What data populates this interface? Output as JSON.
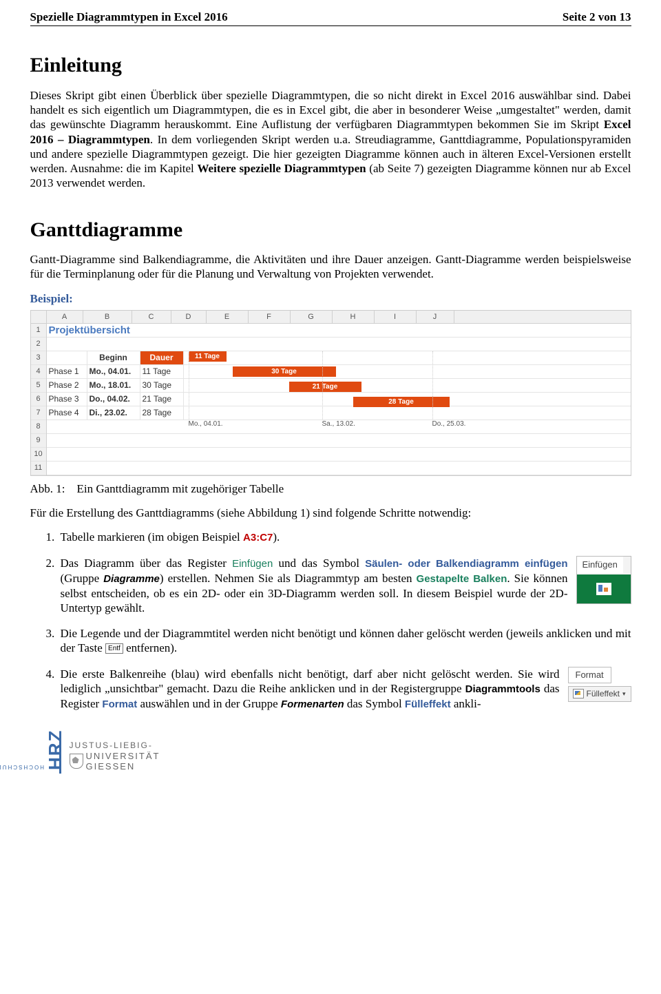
{
  "header": {
    "left": "Spezielle Diagrammtypen in Excel 2016",
    "right": "Seite 2 von 13"
  },
  "section1": {
    "title": "Einleitung",
    "para": "Dieses Skript gibt einen Überblick über spezielle Diagrammtypen, die so nicht direkt in Excel 2016 auswählbar sind. Dabei handelt es sich eigentlich um Diagrammtypen, die es in Excel gibt, die aber in besonderer Weise „umgestaltet\" werden, damit das gewünschte Diagramm herauskommt. Eine Auflistung der verfügbaren Diagrammtypen bekommen Sie im Skript ",
    "bold1": "Excel 2016 – Diagrammtypen",
    "mid": ". In dem vorliegenden Skript werden u.a. Streudiagramme, Ganttdiagramme, Populationspyramiden und andere spezielle Diagrammtypen gezeigt. Die hier gezeigten Diagramme können auch in älteren Excel-Versionen erstellt werden. Ausnahme: die im Kapitel ",
    "bold2": "Weitere spezielle Diagrammtypen",
    "tail": " (ab Seite 7) gezeigten Diagramme können nur ab Excel 2013 verwendet werden."
  },
  "section2": {
    "title": "Ganttdiagramme",
    "para": "Gantt-Diagramme sind Balkendiagramme, die Aktivitäten und ihre Dauer anzeigen. Gantt-Diagramme werden beispielsweise für die Terminplanung oder für die Planung und Verwaltung von Projekten verwendet.",
    "example_label": "Beispiel:"
  },
  "excel": {
    "cols": [
      "A",
      "B",
      "C",
      "D",
      "E",
      "F",
      "G",
      "H",
      "I",
      "J"
    ],
    "rows": [
      "1",
      "2",
      "3",
      "4",
      "5",
      "6",
      "7",
      "8",
      "9",
      "10",
      "11"
    ],
    "title": "Projektübersicht",
    "hdr_b": "Beginn",
    "hdr_c": "Dauer",
    "data": [
      {
        "phase": "Phase 1",
        "beginn": "Mo., 04.01.",
        "dauer": "11 Tage"
      },
      {
        "phase": "Phase 2",
        "beginn": "Mo., 18.01.",
        "dauer": "30 Tage"
      },
      {
        "phase": "Phase 3",
        "beginn": "Do., 04.02.",
        "dauer": "21 Tage"
      },
      {
        "phase": "Phase 4",
        "beginn": "Di., 23.02.",
        "dauer": "28 Tage"
      }
    ],
    "bars": [
      {
        "label": "11 Tage"
      },
      {
        "label": "30 Tage"
      },
      {
        "label": "21 Tage"
      },
      {
        "label": "28 Tage"
      }
    ],
    "axis": [
      "Mo., 04.01.",
      "Sa., 13.02.",
      "Do., 25.03."
    ]
  },
  "caption": {
    "label": "Abb. 1:",
    "text": "Ein Ganttdiagramm mit zugehöriger Tabelle"
  },
  "after_fig": "Für die Erstellung des Ganttdiagramms (siehe Abbildung 1) sind folgende Schritte notwendig:",
  "steps": {
    "s1_a": "Tabelle markieren (im obigen Beispiel ",
    "s1_ref": "A3:C7",
    "s1_b": ").",
    "s2_a": "Das Diagramm über das Register ",
    "s2_tab": "Einfügen",
    "s2_b": " und das Symbol ",
    "s2_cmd": "Säulen- oder Balkendiagramm einfügen",
    "s2_c": " (Gruppe ",
    "s2_grp": "Diagramme",
    "s2_d": ") erstellen. Nehmen Sie als Diagrammtyp am besten ",
    "s2_type": "Gestapelte Balken",
    "s2_e": ". Sie können selbst entscheiden, ob es ein 2D- oder ein 3D-Diagramm werden soll. In diesem Beispiel wurde der 2D-Untertyp gewählt.",
    "s3_a": "Die Legende und der Diagrammtitel werden nicht benötigt und können daher gelöscht werden (jeweils anklicken und mit der Taste ",
    "s3_key": "Entf",
    "s3_b": " entfernen).",
    "s4_a": "Die erste Balkenreihe (blau) wird ebenfalls nicht benötigt, darf aber nicht gelöscht werden. Sie wird lediglich „unsichtbar\" gemacht. Dazu die Reihe anklicken und in der Registergruppe ",
    "s4_grp": "Diagrammtools",
    "s4_b": " das Register ",
    "s4_tab": "Format",
    "s4_c": " auswählen und in der Gruppe ",
    "s4_grp2": "Formenarten",
    "s4_d": " das Symbol ",
    "s4_cmd": "Fülleffekt",
    "s4_e": " ankli-"
  },
  "snap1": {
    "tab": "Einfügen"
  },
  "snap2": {
    "tab": "Format",
    "btn": "Fülleffekt"
  },
  "footer": {
    "hrz": "HRZ",
    "hrz_sub": "HOCHSCHULRECHENZENTRUM",
    "jlu1": "JUSTUS-LIEBIG-",
    "jlu2": "UNIVERSITÄT",
    "jlu3": "GIESSEN"
  }
}
